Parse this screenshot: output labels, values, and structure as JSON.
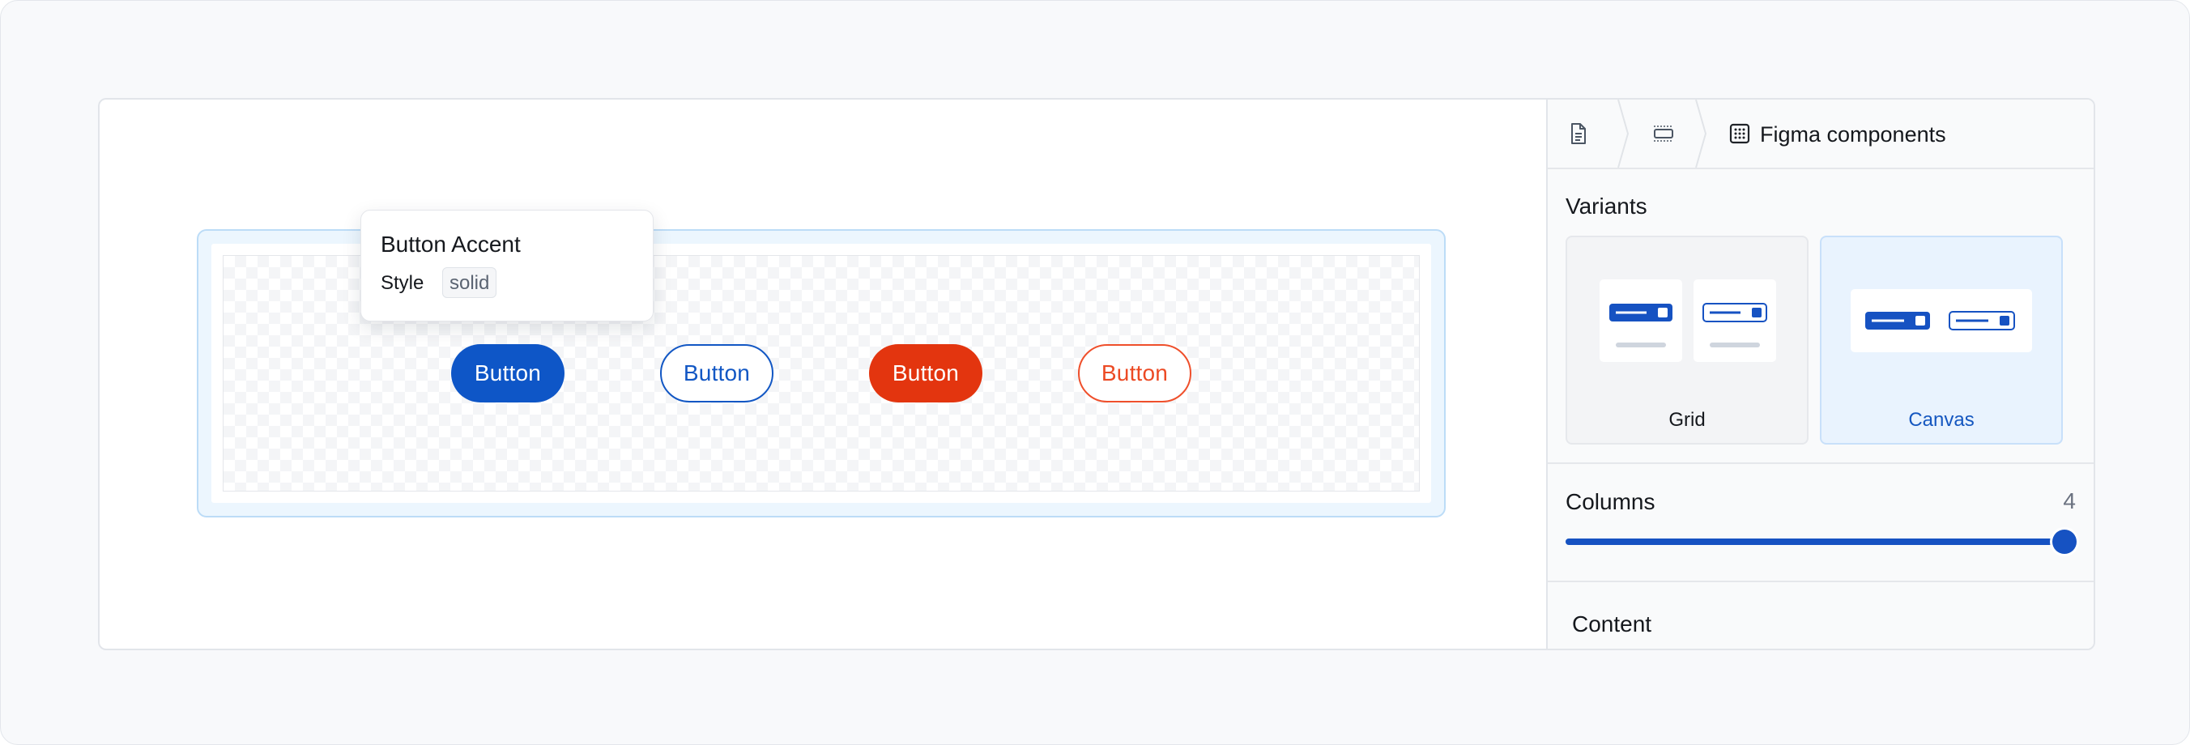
{
  "colors": {
    "accent": "#0e56c7",
    "danger": "#e3350f",
    "selection": "#bcdcf7",
    "selected_variant_bg": "#e9f3fe"
  },
  "canvas": {
    "tooltip": {
      "title": "Button Accent",
      "style_label": "Style",
      "style_value": "solid"
    },
    "buttons": [
      {
        "label": "Button",
        "variant": "accent-solid"
      },
      {
        "label": "Button",
        "variant": "accent-outline"
      },
      {
        "label": "Button",
        "variant": "danger-solid"
      },
      {
        "label": "Button",
        "variant": "danger-outline"
      }
    ]
  },
  "panel": {
    "breadcrumb": {
      "items": [
        {
          "icon": "document-icon"
        },
        {
          "icon": "frame-icon"
        },
        {
          "icon": "component-grid-icon",
          "label": "Figma components"
        }
      ]
    },
    "variants": {
      "title": "Variants",
      "options": [
        {
          "label": "Grid",
          "selected": false
        },
        {
          "label": "Canvas",
          "selected": true
        }
      ]
    },
    "columns": {
      "label": "Columns",
      "value": "4",
      "slider_fraction": 1.0
    },
    "content": {
      "title": "Content"
    }
  }
}
